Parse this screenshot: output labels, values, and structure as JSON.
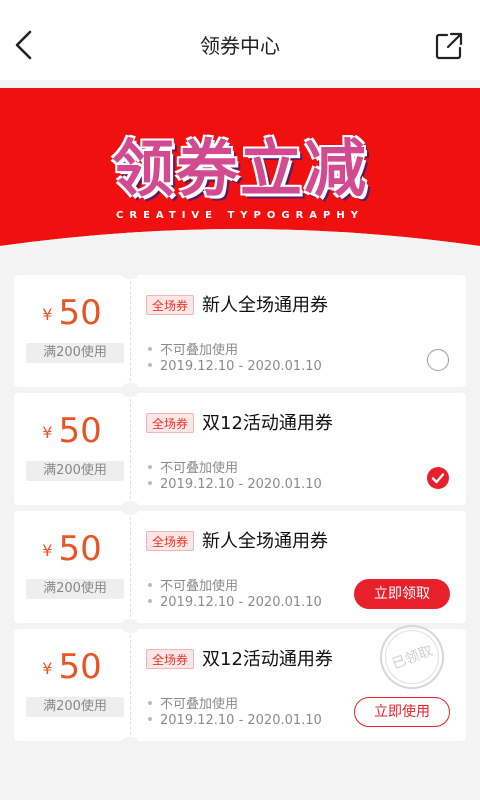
{
  "header": {
    "title": "领券中心",
    "back_icon": "chevron-left-icon",
    "share_icon": "share-icon"
  },
  "banner": {
    "title": "领券立减",
    "subtitle": "CREATIVE TYPOGRAPHY",
    "bg_color": "#f01010"
  },
  "coupons": [
    {
      "currency": "¥",
      "amount": "50",
      "condition": "满200使用",
      "tag": "全场券",
      "name": "新人全场通用券",
      "rule": "不可叠加使用",
      "period": "2019.12.10 - 2020.01.10",
      "state": "unchecked"
    },
    {
      "currency": "¥",
      "amount": "50",
      "condition": "满200使用",
      "tag": "全场券",
      "name": "双12活动通用券",
      "rule": "不可叠加使用",
      "period": "2019.12.10 - 2020.01.10",
      "state": "checked"
    },
    {
      "currency": "¥",
      "amount": "50",
      "condition": "满200使用",
      "tag": "全场券",
      "name": "新人全场通用券",
      "rule": "不可叠加使用",
      "period": "2019.12.10 - 2020.01.10",
      "action_label": "立即领取"
    },
    {
      "currency": "¥",
      "amount": "50",
      "condition": "满200使用",
      "tag": "全场券",
      "name": "双12活动通用券",
      "rule": "不可叠加使用",
      "period": "2019.12.10 - 2020.01.10",
      "action_label": "立即使用",
      "stamp": "已领取"
    }
  ],
  "colors": {
    "accent": "#e8202c",
    "price": "#e85524"
  }
}
